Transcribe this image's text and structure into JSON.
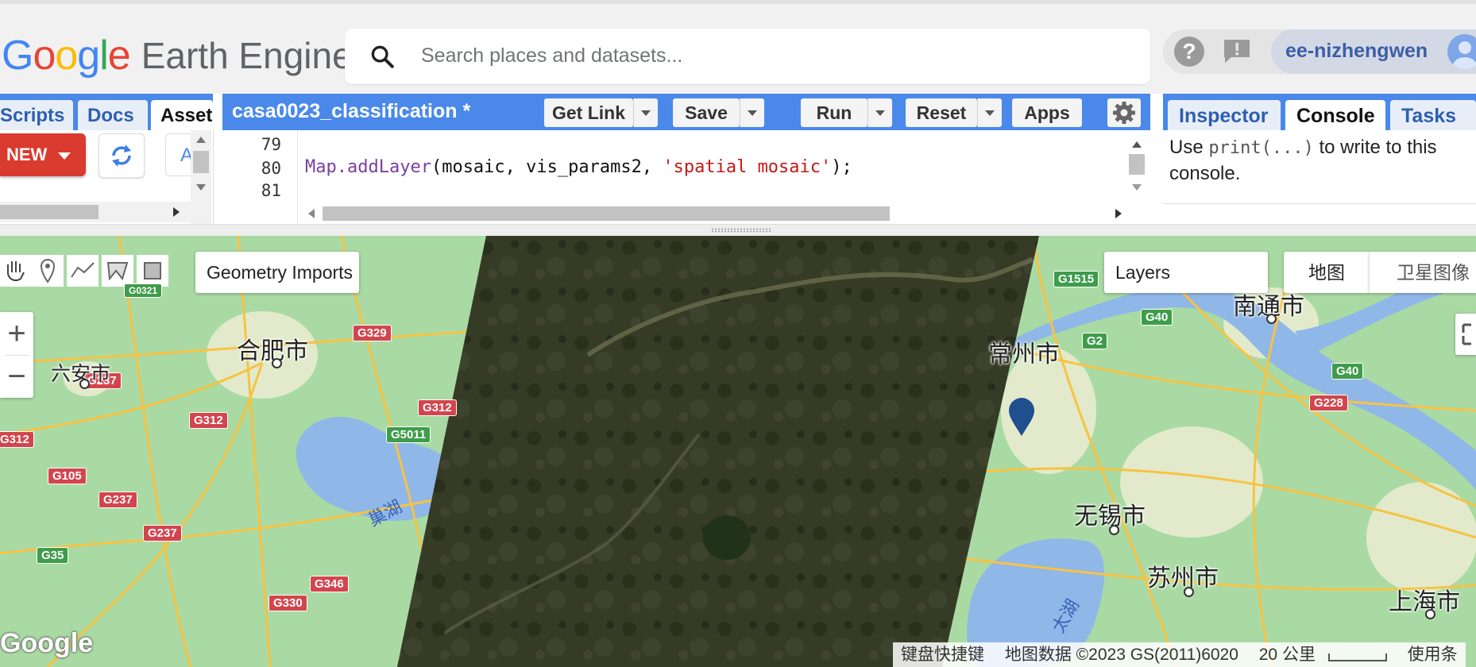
{
  "header": {
    "logo_google": "Google",
    "logo_product": "Earth Engine",
    "search_placeholder": "Search places and datasets...",
    "username": "ee-nizhengwen",
    "help_icon": "question-circle-icon",
    "feedback_icon": "feedback-icon"
  },
  "left_panel": {
    "tabs": [
      {
        "label": "Scripts"
      },
      {
        "label": "Docs"
      },
      {
        "label": "Assets",
        "visible_text": "Asset",
        "active": true
      }
    ],
    "new_label": "NEW",
    "refresh_icon": "refresh-icon",
    "partial_button_label": "A"
  },
  "editor": {
    "title": "casa0023_classification *",
    "buttons": {
      "get_link": "Get Link",
      "save": "Save",
      "run": "Run",
      "reset": "Reset",
      "apps": "Apps"
    },
    "settings_icon": "gear-icon",
    "line_numbers": [
      "79",
      "80",
      "81"
    ],
    "code_line": {
      "fn": "Map.addLayer",
      "args": "(mosaic, vis_params2, ",
      "string": "'spatial mosaic'",
      "end": ");"
    }
  },
  "right_panel": {
    "tabs": [
      {
        "label": "Inspector"
      },
      {
        "label": "Console",
        "active": true
      },
      {
        "label": "Tasks"
      }
    ],
    "console_prefix": "Use ",
    "console_code": "print(...)",
    "console_suffix": " to write to this console."
  },
  "map": {
    "geometry_imports": "Geometry Imports",
    "layers": "Layers",
    "map_type_map": "地图",
    "map_type_satellite": "卫星图像",
    "zoom_in": "+",
    "zoom_out": "−",
    "watermark": "Google",
    "attribution": {
      "shortcuts": "键盘快捷键",
      "data": "地图数据 ©2023 GS(2011)6020",
      "scale": "20 公里",
      "terms": "使用条"
    },
    "cities": {
      "hefei": "合肥市",
      "luan": "六安市",
      "nantong": "南通市",
      "changzhou_partial": "常州市",
      "wuxi": "无锡市",
      "suzhou": "苏州市",
      "shanghai": "上海市"
    },
    "lakes": {
      "chaohu": "巢湖",
      "taihu": "太湖"
    },
    "highways": {
      "G329": "G329",
      "G237a": "G237",
      "G312a": "G312",
      "G312b": "G312",
      "G312c": "G312",
      "G105": "G105",
      "G237b": "G237",
      "G237c": "G237",
      "G5011": "G5011",
      "G35": "G35",
      "G346": "G346",
      "G330": "G330",
      "G1515": "G1515",
      "G40a": "G40",
      "G2": "G2",
      "G40b": "G40",
      "G228": "G228",
      "G0321": "G0321"
    }
  },
  "colors": {
    "accent_blue": "#4a89ea",
    "new_red": "#d93b2f",
    "map_green": "#aadaa4",
    "water": "#8fb7e8",
    "road_yellow": "#f6c343",
    "satellite_dark": "#2e321f"
  }
}
